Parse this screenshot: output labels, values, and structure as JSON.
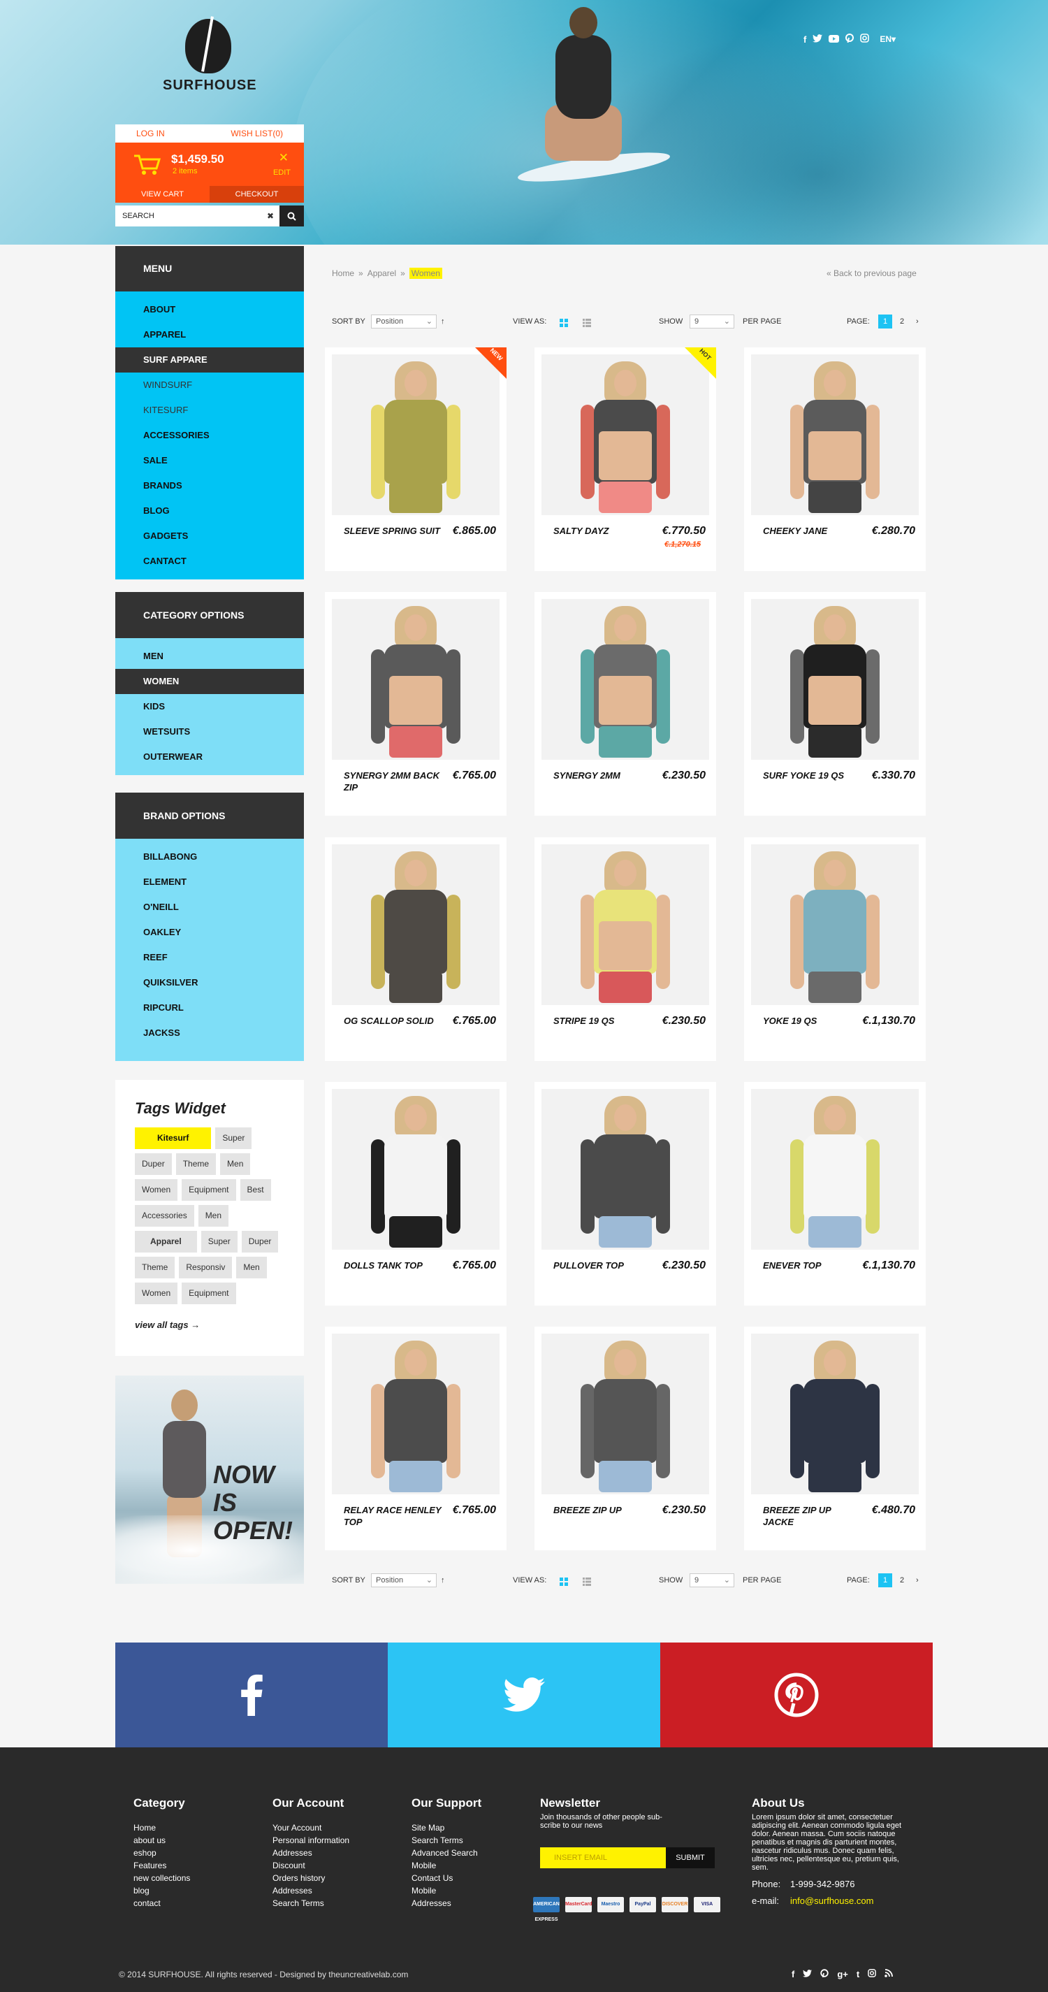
{
  "brand": {
    "name": "SURFHOUSE"
  },
  "top_social": {
    "icons": [
      "facebook-icon",
      "twitter-icon",
      "youtube-icon",
      "pinterest-icon",
      "instagram-icon"
    ],
    "lang": "EN"
  },
  "account": {
    "login": "LOG IN",
    "wishlist": "WISH LIST(0)"
  },
  "cart": {
    "total": "$1,459.50",
    "items": "2 items",
    "edit": "EDIT",
    "view_cart": "VIEW CART",
    "checkout": "CHECKOUT"
  },
  "search": {
    "value": "SEARCH"
  },
  "menu": {
    "title": "MENU",
    "items": [
      {
        "label": "ABOUT"
      },
      {
        "label": "APPAREL"
      },
      {
        "label": "SURF APPARE",
        "active": true
      },
      {
        "label": "WINDSURF",
        "alt": true
      },
      {
        "label": "KITESURF",
        "alt": true
      },
      {
        "label": "ACCESSORIES"
      },
      {
        "label": "SALE"
      },
      {
        "label": "BRANDS"
      },
      {
        "label": "BLOG"
      },
      {
        "label": "GADGETS"
      },
      {
        "label": "CANTACT"
      }
    ]
  },
  "categories": {
    "title": "CATEGORY OPTIONS",
    "items": [
      {
        "label": "MEN"
      },
      {
        "label": "WOMEN",
        "active": true
      },
      {
        "label": "KIDS"
      },
      {
        "label": "WETSUITS"
      },
      {
        "label": "OUTERWEAR"
      }
    ]
  },
  "brands": {
    "title": "BRAND OPTIONS",
    "items": [
      {
        "label": "BILLABONG"
      },
      {
        "label": "ELEMENT"
      },
      {
        "label": "O'NEILL"
      },
      {
        "label": "OAKLEY"
      },
      {
        "label": "REEF"
      },
      {
        "label": "QUIKSILVER"
      },
      {
        "label": "RIPCURL"
      },
      {
        "label": "JACKSS"
      }
    ]
  },
  "tags": {
    "title": "Tags Widget",
    "items": [
      {
        "label": "Kitesurf",
        "style": "hl"
      },
      {
        "label": "Super"
      },
      {
        "label": "Duper"
      },
      {
        "label": "Theme"
      },
      {
        "label": "Men"
      },
      {
        "label": "Women"
      },
      {
        "label": "Equipment"
      },
      {
        "label": "Best"
      },
      {
        "label": "Accessories"
      },
      {
        "label": "Men"
      },
      {
        "label": "Apparel",
        "style": "bold"
      },
      {
        "label": "Super"
      },
      {
        "label": "Duper"
      },
      {
        "label": "Theme"
      },
      {
        "label": "Responsiv"
      },
      {
        "label": "Men"
      },
      {
        "label": "Women"
      },
      {
        "label": "Equipment"
      }
    ],
    "view_all": "view all tags"
  },
  "promo": {
    "line1": "NOW",
    "line2": "IS",
    "line3": "OPEN!"
  },
  "breadcrumb": {
    "home": "Home",
    "apparel": "Apparel",
    "current": "Women",
    "sep": "»"
  },
  "back_link": "« Back to previous page",
  "toolbar": {
    "sort_by": "SORT BY",
    "sort_value": "Position",
    "view_as": "VIEW AS:",
    "show": "SHOW",
    "show_value": "9",
    "per_page": "PER PAGE",
    "page": "PAGE:",
    "page1": "1",
    "page2": "2"
  },
  "products": [
    {
      "name": "SLEEVE SPRING SUIT",
      "price": "€.865.00",
      "badge": "NEW",
      "badge_color": "#ff4e10",
      "torso": "#a9a24b",
      "arms": "#e6d86a",
      "bottom": "#a9a24b",
      "skin": false
    },
    {
      "name": "SALTY DAYZ",
      "price": "€.770.50",
      "old_price": "€.1,270.15",
      "badge": "HOT",
      "badge_color": "#fff200",
      "torso": "#4b4b4b",
      "arms": "#d8685a",
      "bottom": "#f08a86",
      "skin": true
    },
    {
      "name": "CHEEKY JANE",
      "price": "€.280.70",
      "torso": "#5b5b5b",
      "arms": "#e3b895",
      "bottom": "#444",
      "skin": true
    },
    {
      "name": "SYNERGY 2MM BACK ZIP",
      "price": "€.765.00",
      "torso": "#5a5a5a",
      "arms": "#5a5a5a",
      "bottom": "#e06a6a",
      "skin": true
    },
    {
      "name": "SYNERGY 2MM",
      "price": "€.230.50",
      "torso": "#6b6b6b",
      "arms": "#5ca8a5",
      "bottom": "#5ca8a5",
      "skin": true
    },
    {
      "name": "SURF YOKE 19 QS",
      "price": "€.330.70",
      "torso": "#1f1f1f",
      "arms": "#6b6b6b",
      "bottom": "#2b2b2b",
      "skin": true
    },
    {
      "name": "OG SCALLOP SOLID",
      "price": "€.765.00",
      "torso": "#4e4a45",
      "arms": "#c8b35a",
      "bottom": "#4e4a45",
      "skin": false
    },
    {
      "name": "STRIPE 19 QS",
      "price": "€.230.50",
      "torso": "#e8e37a",
      "arms": "#e3b895",
      "bottom": "#d8585a",
      "skin": true
    },
    {
      "name": "YOKE 19 QS",
      "price": "€.1,130.70",
      "torso": "#7db0bf",
      "arms": "#e3b895",
      "bottom": "#6a6a6a",
      "skin": false
    },
    {
      "name": "DOLLS TANK TOP",
      "price": "€.765.00",
      "torso": "#f3f3f3",
      "arms": "#202020",
      "bottom": "#202020",
      "skin": false
    },
    {
      "name": "PULLOVER TOP",
      "price": "€.230.50",
      "torso": "#4b4b4b",
      "arms": "#4b4b4b",
      "bottom": "#9dbad6",
      "skin": false
    },
    {
      "name": "ENEVER TOP",
      "price": "€.1,130.70",
      "torso": "#f6f6f6",
      "arms": "#d8d86a",
      "bottom": "#9dbad6",
      "skin": false
    },
    {
      "name": "RELAY RACE HENLEY TOP",
      "price": "€.765.00",
      "torso": "#4c4c4c",
      "arms": "#e3b895",
      "bottom": "#9dbad6",
      "skin": false
    },
    {
      "name": "BREEZE ZIP UP",
      "price": "€.230.50",
      "torso": "#555555",
      "arms": "#666666",
      "bottom": "#9dbad6",
      "skin": false
    },
    {
      "name": "BREEZE ZIP UP JACKE",
      "price": "€.480.70",
      "torso": "#2d3444",
      "arms": "#2d3444",
      "bottom": "#2d3444",
      "skin": false
    }
  ],
  "social_big": [
    {
      "icon": "facebook-icon",
      "color": "#3b5797"
    },
    {
      "icon": "twitter-icon",
      "color": "#2cc4f4"
    },
    {
      "icon": "pinterest-icon",
      "color": "#cb1e24"
    }
  ],
  "footer": {
    "category": {
      "title": "Category",
      "links": [
        "Home",
        "about us",
        "eshop",
        "Features",
        "new collections",
        "blog",
        "contact"
      ]
    },
    "account": {
      "title": "Our Account",
      "links": [
        "Your Account",
        "Personal information",
        "Addresses",
        "Discount",
        "Orders history",
        "Addresses",
        "Search Terms"
      ]
    },
    "support": {
      "title": "Our Support",
      "links": [
        "Site Map",
        "Search Terms",
        "Advanced Search",
        "Mobile",
        "Contact Us",
        "Mobile",
        "Addresses"
      ]
    },
    "newsletter": {
      "title": "Newsletter",
      "text": "Join thousands of other people sub-scribe to our news",
      "placeholder": "INSERT EMAIL",
      "submit": "SUBMIT"
    },
    "payments": [
      "AMERICAN EXPRESS",
      "MasterCard",
      "Maestro",
      "PayPal",
      "DISCOVER",
      "VISA"
    ],
    "about": {
      "title": "About Us",
      "text": "Lorem ipsum dolor sit amet, consectetuer adipiscing elit. Aenean commodo ligula eget dolor. Aenean massa. Cum sociis natoque penatibus et magnis dis parturient montes, nascetur ridiculus mus. Donec quam felis, ultricies nec, pellentesque eu, pretium quis, sem.",
      "phone_label": "Phone:",
      "phone": "1-999-342-9876",
      "email_label": "e-mail:",
      "email": "info@surfhouse.com"
    },
    "copyright": "© 2014  SURFHOUSE. All rights reserved - Designed by theuncreativelab.com"
  }
}
